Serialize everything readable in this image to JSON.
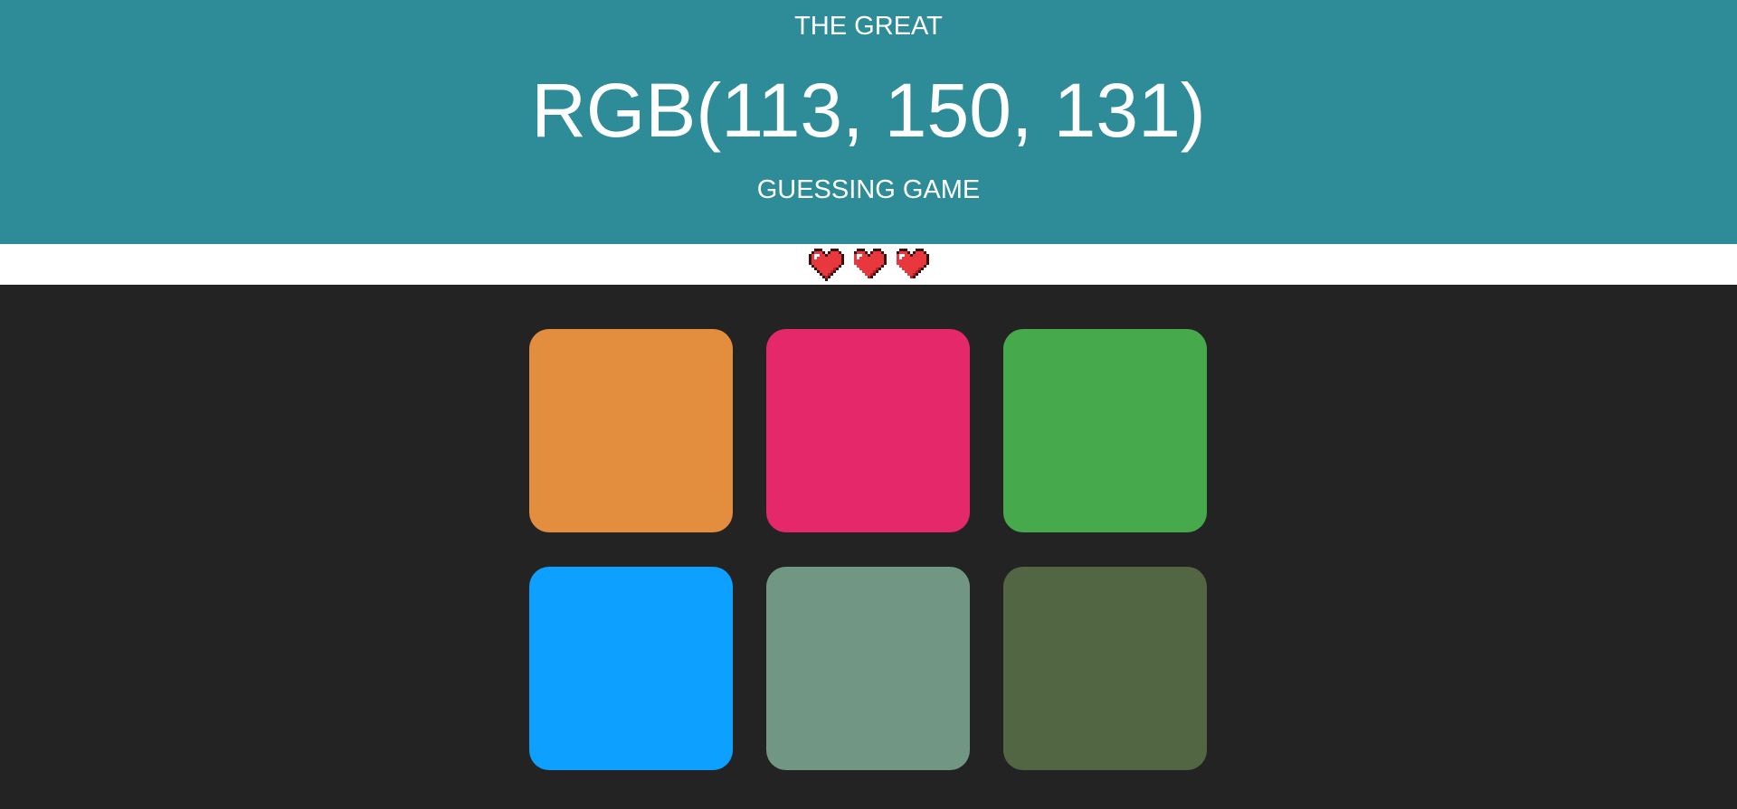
{
  "header": {
    "title_top": "THE GREAT",
    "target_rgb": "RGB(113, 150, 131)",
    "title_bottom": "GUESSING GAME",
    "background": "#2e8c99"
  },
  "lives": {
    "count": 3,
    "icon": "heart-icon",
    "color": "#e8383d"
  },
  "squares": [
    {
      "color": "#e38d3f"
    },
    {
      "color": "#e5286a"
    },
    {
      "color": "#46aa4d"
    },
    {
      "color": "#0da0ff"
    },
    {
      "color": "#719683"
    },
    {
      "color": "#536644"
    }
  ],
  "board_background": "#232323"
}
